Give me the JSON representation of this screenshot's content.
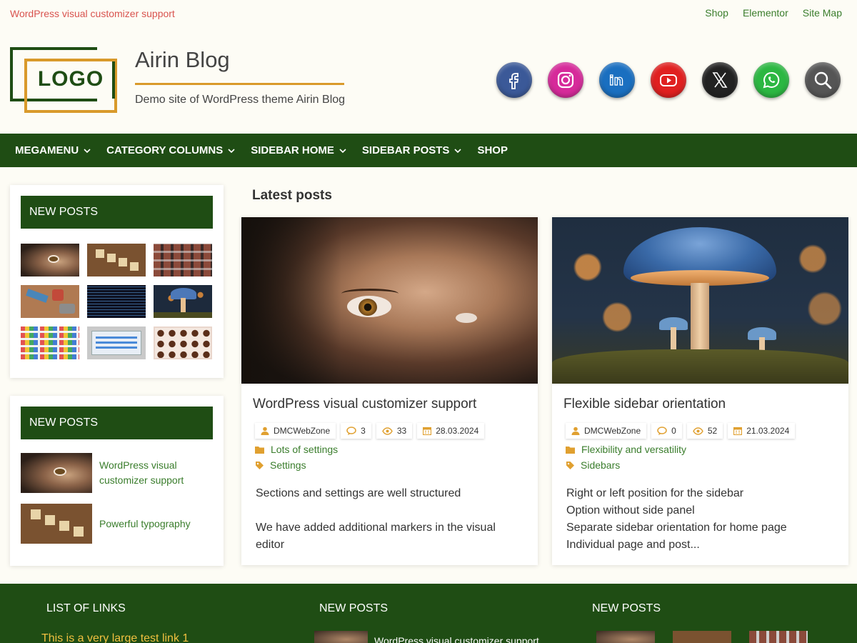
{
  "topbar": {
    "notice": "WordPress visual customizer support",
    "links": [
      "Shop",
      "Elementor",
      "Site Map"
    ]
  },
  "header": {
    "logo_text": "LOGO",
    "site_title": "Airin Blog",
    "site_description": "Demo site of WordPress theme Airin Blog",
    "social": [
      {
        "name": "facebook-icon",
        "color": "#3b5998"
      },
      {
        "name": "instagram-icon",
        "color": "#d62a9a"
      },
      {
        "name": "linkedin-icon",
        "color": "#1a6fc0"
      },
      {
        "name": "youtube-icon",
        "color": "#e02020"
      },
      {
        "name": "x-icon",
        "color": "#222222"
      },
      {
        "name": "whatsapp-icon",
        "color": "#2cb742"
      },
      {
        "name": "search-icon",
        "color": "#555555"
      }
    ]
  },
  "nav": {
    "items": [
      {
        "label": "MEGAMENU",
        "has_dropdown": true
      },
      {
        "label": "CATEGORY COLUMNS",
        "has_dropdown": true
      },
      {
        "label": "SIDEBAR HOME",
        "has_dropdown": true
      },
      {
        "label": "SIDEBAR POSTS",
        "has_dropdown": true
      },
      {
        "label": "SHOP",
        "has_dropdown": false
      }
    ]
  },
  "sidebar": {
    "widget1": {
      "title": "NEW POSTS"
    },
    "widget2": {
      "title": "NEW POSTS",
      "posts": [
        {
          "title": "WordPress visual customizer support"
        },
        {
          "title": "Powerful typography"
        }
      ]
    }
  },
  "main": {
    "heading": "Latest posts",
    "posts": [
      {
        "title": "WordPress visual customizer support",
        "author": "DMCWebZone",
        "comments": "3",
        "views": "33",
        "date": "28.03.2024",
        "category": "Lots of settings",
        "tag": "Settings",
        "excerpt": [
          "Sections and settings are well structured",
          "",
          "We have added additional markers in the visual editor"
        ]
      },
      {
        "title": "Flexible sidebar orientation",
        "author": "DMCWebZone",
        "comments": "0",
        "views": "52",
        "date": "21.03.2024",
        "category": "Flexibility and versatility",
        "tag": "Sidebars",
        "excerpt": [
          "Right or left position for the sidebar",
          "Option without side panel",
          "Separate sidebar orientation for home page",
          "Individual page and post..."
        ]
      }
    ]
  },
  "footer": {
    "col1_title": "LIST OF LINKS",
    "col2_title": "NEW POSTS",
    "col3_title": "NEW POSTS",
    "first_link": "This is a very large test link 1",
    "snippet": "WordPress visual customizer support"
  },
  "colors": {
    "brand_green": "#1f4d14",
    "accent_gold": "#d99a2b",
    "link_green": "#3a7d2c",
    "notice_red": "#d9534f"
  }
}
